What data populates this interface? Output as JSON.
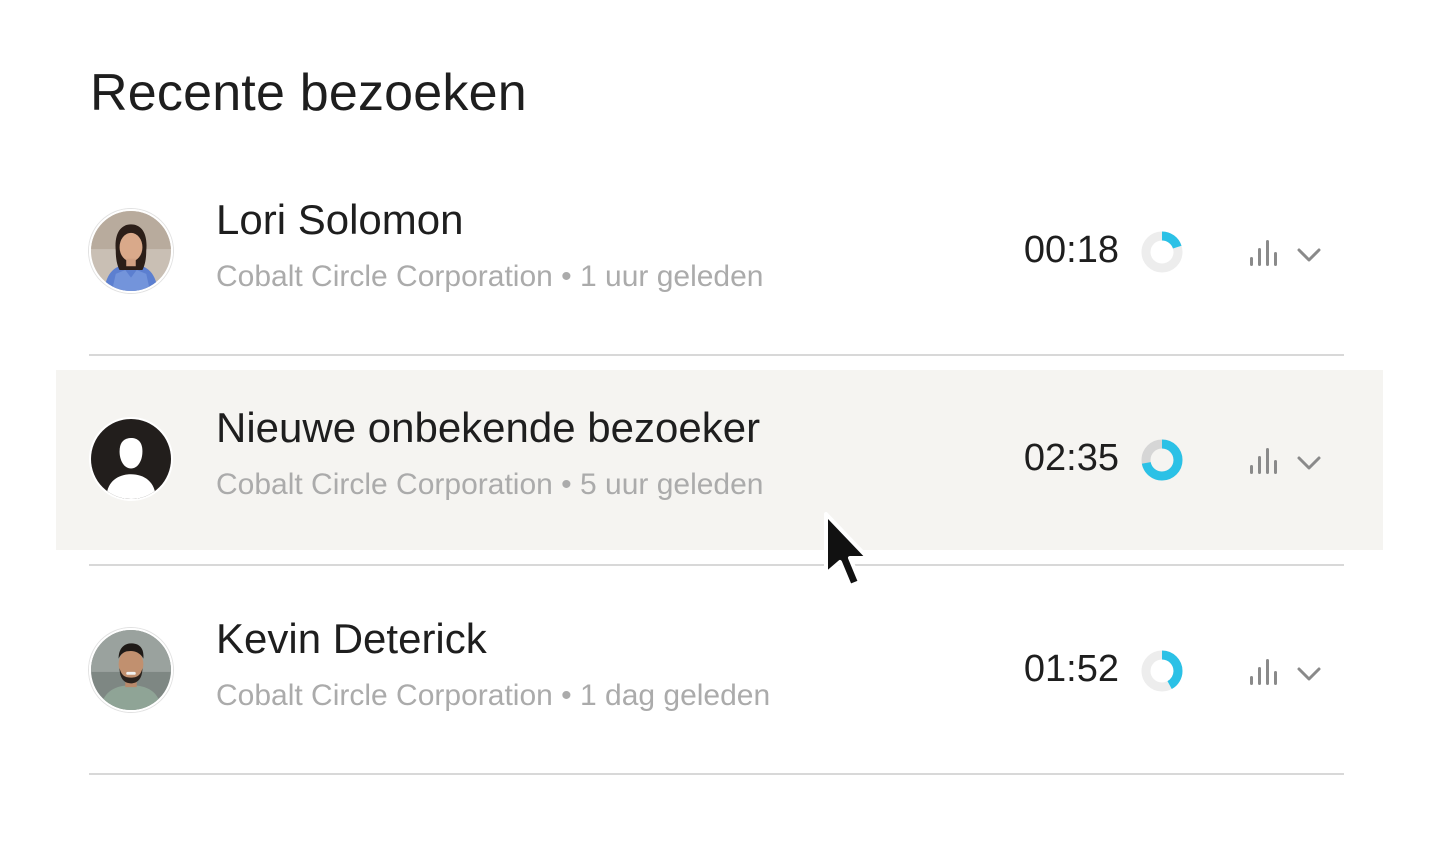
{
  "page": {
    "title": "Recente bezoeken"
  },
  "visits": [
    {
      "name": "Lori Solomon",
      "company": "Cobalt Circle Corporation",
      "separator": "•",
      "time_ago": "1 uur geleden",
      "meta": "Cobalt Circle Corporation • 1 uur geleden",
      "duration": "00:18",
      "avatar": "photo",
      "progress_icon": "donut-progress-icon",
      "progress_fraction": 0.2,
      "stats_icon": "bar-chart-icon",
      "expand_icon": "chevron-down-icon"
    },
    {
      "name": "Nieuwe onbekende bezoeker",
      "company": "Cobalt Circle Corporation",
      "separator": "•",
      "time_ago": "5 uur geleden",
      "meta": "Cobalt Circle Corporation • 5 uur geleden",
      "duration": "02:35",
      "avatar": "placeholder",
      "progress_icon": "donut-progress-icon",
      "progress_fraction": 0.72,
      "stats_icon": "bar-chart-icon",
      "expand_icon": "chevron-down-icon",
      "hovered": true
    },
    {
      "name": "Kevin Deterick",
      "company": "Cobalt Circle Corporation",
      "separator": "•",
      "time_ago": "1 dag geleden",
      "meta": "Cobalt Circle Corporation • 1 dag geleden",
      "duration": "01:52",
      "avatar": "photo",
      "progress_icon": "donut-progress-icon",
      "progress_fraction": 0.42,
      "stats_icon": "bar-chart-icon",
      "expand_icon": "chevron-down-icon"
    }
  ],
  "colors": {
    "accent": "#2bc1e6",
    "track": "#ededed",
    "track_strong": "#d6d6d6",
    "hover_bg": "#f5f4f1",
    "meta_text": "#ababab",
    "icon": "#8a8a8a"
  }
}
